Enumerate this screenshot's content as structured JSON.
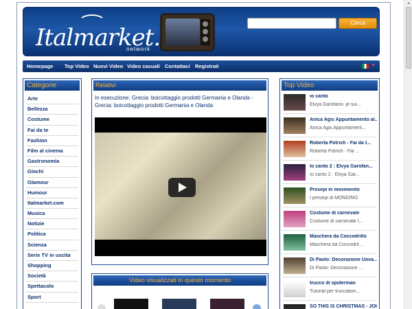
{
  "header": {
    "logo_text": "Italmarket.tv",
    "logo_sub": "network",
    "search_button": "Cerca",
    "search_value": ""
  },
  "nav": {
    "items": [
      "Homepage",
      "Top Video",
      "Nuovi Video",
      "Video casuali",
      "Contattaci",
      "Registrati"
    ]
  },
  "sidebar": {
    "title": "Categorie",
    "items": [
      "Arte",
      "Bellezza",
      "Costume",
      "Fai da te",
      "Fashion",
      "Film al cinema",
      "Gastronomia",
      "Giochi",
      "Glamour",
      "Humour",
      "Italmarket.com",
      "Musica",
      "Notizie",
      "Politica",
      "Scienza",
      "Serie TV in uscita",
      "Shopping",
      "Società",
      "Spettacolo",
      "Sport"
    ]
  },
  "center": {
    "title": "Relativi",
    "now_playing_prefix": "In esecuzione:",
    "now_playing_text": "Grecia: boicottaggio prodotti Germania e Olanda - Grecia: boicottaggio prodotti Germania e Olanda"
  },
  "bottom": {
    "title": "Video visualizzati in questo momento"
  },
  "top_video": {
    "title": "Top Video",
    "items": [
      {
        "name": "io canto",
        "desc": "Elvya Garofano- je sui..."
      },
      {
        "name": "Anica Agis Appuntamento al...",
        "desc": "Anica Agis Appuntament..."
      },
      {
        "name": "Roberta Potrich - Fai da t...",
        "desc": "Roberta Potrich - Fai ..."
      },
      {
        "name": "Io canto 2 : Elvya Garofan...",
        "desc": "Io canto 2 : Elvya Gar..."
      },
      {
        "name": "Presepi in movimento",
        "desc": "I presepi di MONDINO"
      },
      {
        "name": "Costume di carnevale",
        "desc": "Costume di carnevale l..."
      },
      {
        "name": "Maschera da Coccodrillo",
        "desc": "Maschera da Coccodril..."
      },
      {
        "name": "Di Paolo: Decorazione Uova...",
        "desc": "Di Paolo: Decorazione ..."
      },
      {
        "name": "trucco di spiderman",
        "desc": "Tutorial per truccabim..."
      },
      {
        "name": "SO THIS IS CHRISTMAS - JOHN...",
        "desc": ""
      }
    ]
  },
  "colors": {
    "brand_blue": "#0e3f86",
    "accent_orange": "#f7b23a"
  }
}
